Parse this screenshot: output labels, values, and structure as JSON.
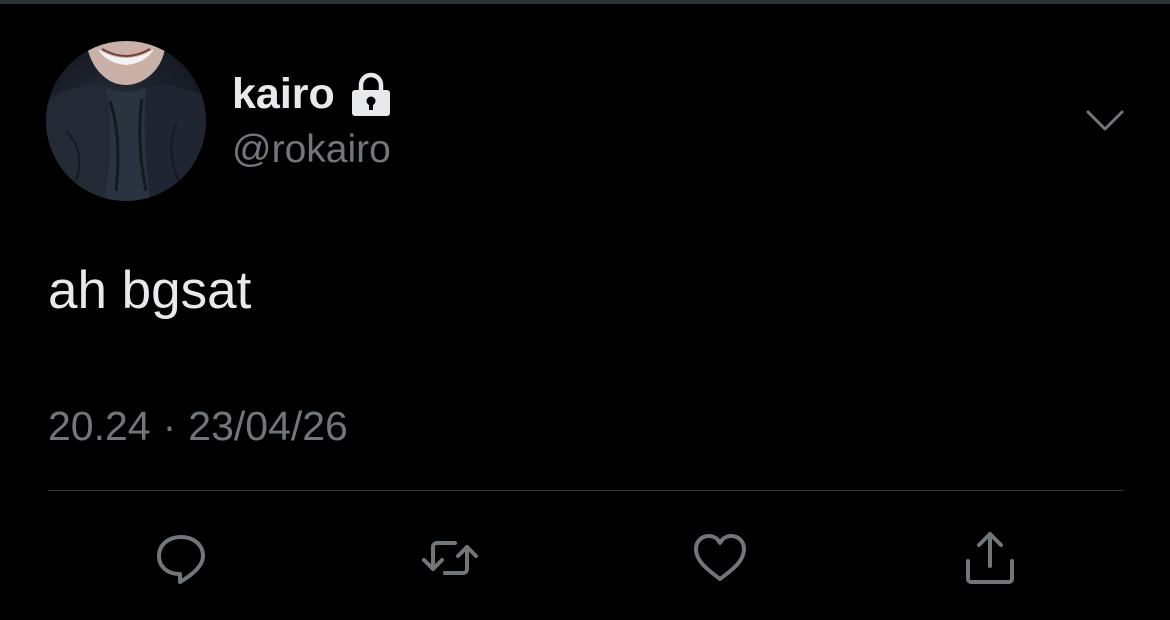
{
  "tweet": {
    "author": {
      "display_name": "kairo",
      "handle": "@rokairo",
      "protected_icon": "lock-icon"
    },
    "text": "ah bgsat",
    "time": "20.24",
    "separator": "·",
    "date": "23/04/26"
  },
  "actions": [
    {
      "name": "reply",
      "icon": "reply-icon"
    },
    {
      "name": "retweet",
      "icon": "retweet-icon"
    },
    {
      "name": "like",
      "icon": "heart-icon"
    },
    {
      "name": "share",
      "icon": "share-icon"
    }
  ],
  "colors": {
    "background": "#000000",
    "primary_text": "#e7e9ea",
    "secondary_text": "#71767b",
    "divider": "#2f3336"
  }
}
